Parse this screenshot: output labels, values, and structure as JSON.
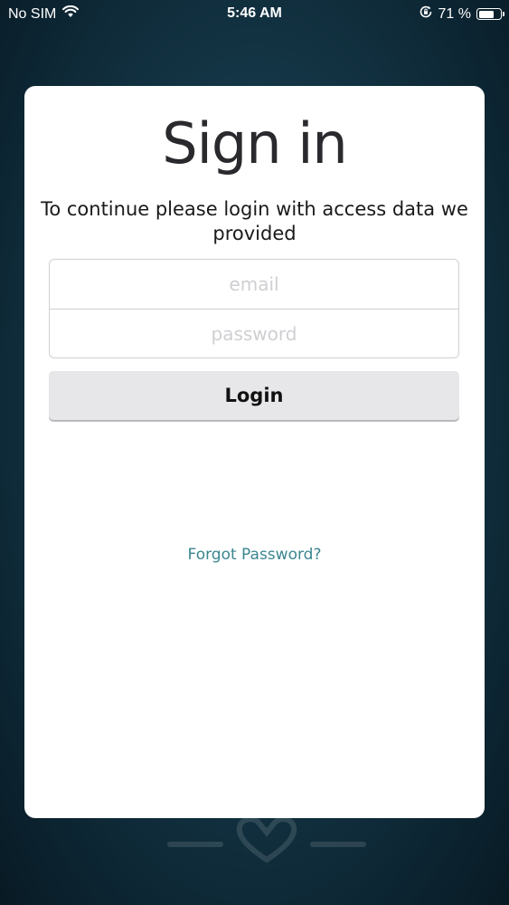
{
  "status_bar": {
    "carrier": "No SIM",
    "time": "5:46 AM",
    "battery_percent": "71 %",
    "battery_level": 0.71
  },
  "login": {
    "title": "Sign in",
    "subtitle": "To continue please login with access data we provided",
    "email_placeholder": "email",
    "email_value": "",
    "password_placeholder": "password",
    "password_value": "",
    "login_label": "Login",
    "forgot_password_label": "Forgot Password?"
  },
  "icons": {
    "wifi": "wifi-icon",
    "orientation_lock": "orientation-lock-icon",
    "battery": "battery-icon",
    "background_logo": "heart-logo"
  },
  "colors": {
    "background_dark": "#0c2431",
    "background_light": "#1e4a5e",
    "card": "#ffffff",
    "button": "#e7e6e9",
    "link": "#3b8690"
  }
}
